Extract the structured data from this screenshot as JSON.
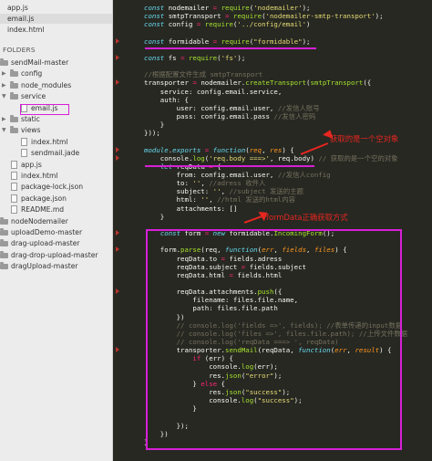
{
  "sidebar": {
    "open_files": [
      {
        "label": "app.js"
      },
      {
        "label": "email.js"
      },
      {
        "label": "index.html"
      }
    ],
    "folders_heading": "FOLDERS",
    "tree": [
      {
        "label": "sendMail-master",
        "kind": "folder",
        "depth": 0,
        "open": true
      },
      {
        "label": "config",
        "kind": "folder",
        "depth": 1,
        "open": false
      },
      {
        "label": "node_modules",
        "kind": "folder",
        "depth": 1,
        "open": false
      },
      {
        "label": "service",
        "kind": "folder",
        "depth": 1,
        "open": true
      },
      {
        "label": "email.js",
        "kind": "file",
        "depth": 2,
        "active": true
      },
      {
        "label": "static",
        "kind": "folder",
        "depth": 1,
        "open": false
      },
      {
        "label": "views",
        "kind": "folder",
        "depth": 1,
        "open": true
      },
      {
        "label": "index.html",
        "kind": "file",
        "depth": 2
      },
      {
        "label": "sendmail.jade",
        "kind": "file",
        "depth": 2
      },
      {
        "label": "app.js",
        "kind": "file",
        "depth": 1
      },
      {
        "label": "index.html",
        "kind": "file",
        "depth": 1
      },
      {
        "label": "package-lock.json",
        "kind": "file",
        "depth": 1
      },
      {
        "label": "package.json",
        "kind": "file",
        "depth": 1,
        "active": true
      },
      {
        "label": "README.md",
        "kind": "file",
        "depth": 1
      },
      {
        "label": "nodeNodemailer",
        "kind": "folder",
        "depth": 0
      },
      {
        "label": "uploadDemo-master",
        "kind": "folder",
        "depth": 0
      },
      {
        "label": "drag-upload-master",
        "kind": "folder",
        "depth": 0
      },
      {
        "label": "drag-drop-upload-master",
        "kind": "folder",
        "depth": 0
      },
      {
        "label": "dragUpload-master",
        "kind": "folder",
        "depth": 0
      }
    ]
  },
  "editor": {
    "lines": [
      [
        [
          "k",
          "const "
        ],
        [
          "w",
          "nodemailer "
        ],
        [
          "o",
          "= "
        ],
        [
          "f",
          "require"
        ],
        [
          "w",
          "("
        ],
        [
          "s",
          "'nodemailer'"
        ],
        [
          "w",
          ");"
        ]
      ],
      [
        [
          "k",
          "const "
        ],
        [
          "w",
          "smtpTransport "
        ],
        [
          "o",
          "= "
        ],
        [
          "f",
          "require"
        ],
        [
          "w",
          "("
        ],
        [
          "s",
          "'nodemailer-smtp-transport'"
        ],
        [
          "w",
          ");"
        ]
      ],
      [
        [
          "k",
          "const "
        ],
        [
          "w",
          "config "
        ],
        [
          "o",
          "= "
        ],
        [
          "f",
          "require"
        ],
        [
          "w",
          "("
        ],
        [
          "s",
          "'../config/email'"
        ],
        [
          "w",
          ")"
        ]
      ],
      [],
      [
        [
          "k",
          "const "
        ],
        [
          "w",
          "formidable "
        ],
        [
          "o",
          "= "
        ],
        [
          "f",
          "require"
        ],
        [
          "w",
          "("
        ],
        [
          "s",
          "\"formidable\""
        ],
        [
          "w",
          ");"
        ]
      ],
      [],
      [
        [
          "k",
          "const "
        ],
        [
          "w",
          "fs "
        ],
        [
          "o",
          "= "
        ],
        [
          "f",
          "require"
        ],
        [
          "w",
          "("
        ],
        [
          "s",
          "'fs'"
        ],
        [
          "w",
          ");"
        ]
      ],
      [],
      [
        [
          "c",
          "//根据配置文件生成 smtpTransport"
        ]
      ],
      [
        [
          "w",
          "transporter "
        ],
        [
          "o",
          "= "
        ],
        [
          "w",
          "nodemailer."
        ],
        [
          "f",
          "createTransport"
        ],
        [
          "w",
          "("
        ],
        [
          "f",
          "smtpTransport"
        ],
        [
          "w",
          "({"
        ]
      ],
      [
        [
          "w",
          "    service: config.email.service,"
        ]
      ],
      [
        [
          "w",
          "    auth: {"
        ]
      ],
      [
        [
          "w",
          "        user: config.email.user, "
        ],
        [
          "c",
          "//发信人账号"
        ]
      ],
      [
        [
          "w",
          "        pass: config.email.pass "
        ],
        [
          "c",
          "//发信人密码"
        ]
      ],
      [
        [
          "w",
          "    }"
        ]
      ],
      [
        [
          "w",
          "}));"
        ]
      ],
      [],
      [
        [
          "k",
          "module"
        ],
        [
          "w",
          "."
        ],
        [
          "k",
          "exports "
        ],
        [
          "o",
          "= "
        ],
        [
          "k",
          "function"
        ],
        [
          "w",
          "("
        ],
        [
          "p",
          "req"
        ],
        [
          "w",
          ", "
        ],
        [
          "p",
          "res"
        ],
        [
          "w",
          ") {"
        ]
      ],
      [
        [
          "w",
          "    console."
        ],
        [
          "f",
          "log"
        ],
        [
          "w",
          "("
        ],
        [
          "s",
          "'req.body ===>'"
        ],
        [
          "w",
          ", req.body) "
        ],
        [
          "c",
          "// 获取的是一个空的对象"
        ]
      ],
      [
        [
          "w",
          "    "
        ],
        [
          "k",
          "let "
        ],
        [
          "w",
          "reqData "
        ],
        [
          "o",
          "= "
        ],
        [
          "w",
          "{"
        ]
      ],
      [
        [
          "w",
          "        from: config.email.user, "
        ],
        [
          "c",
          "//发信人config"
        ]
      ],
      [
        [
          "w",
          "        to: "
        ],
        [
          "s",
          "''"
        ],
        [
          "w",
          ", "
        ],
        [
          "c",
          "//adress 收件人"
        ]
      ],
      [
        [
          "w",
          "        subject: "
        ],
        [
          "s",
          "''"
        ],
        [
          "w",
          ", "
        ],
        [
          "c",
          "//subject 发送的主题"
        ]
      ],
      [
        [
          "w",
          "        html: "
        ],
        [
          "s",
          "''"
        ],
        [
          "w",
          ", "
        ],
        [
          "c",
          "//html 发送的html内容"
        ]
      ],
      [
        [
          "w",
          "        attachments: []"
        ]
      ],
      [
        [
          "w",
          "    }"
        ]
      ],
      [],
      [
        [
          "w",
          "    "
        ],
        [
          "k",
          "const "
        ],
        [
          "w",
          "form "
        ],
        [
          "o",
          "= "
        ],
        [
          "k",
          "new "
        ],
        [
          "w",
          "formidable."
        ],
        [
          "f",
          "IncomingForm"
        ],
        [
          "w",
          "();"
        ]
      ],
      [],
      [
        [
          "w",
          "    form."
        ],
        [
          "f",
          "parse"
        ],
        [
          "w",
          "(req, "
        ],
        [
          "k",
          "function"
        ],
        [
          "w",
          "("
        ],
        [
          "p",
          "err"
        ],
        [
          "w",
          ", "
        ],
        [
          "p",
          "fields"
        ],
        [
          "w",
          ", "
        ],
        [
          "p",
          "files"
        ],
        [
          "w",
          ") {"
        ]
      ],
      [
        [
          "w",
          "        reqData.to "
        ],
        [
          "o",
          "= "
        ],
        [
          "w",
          "fields.adress"
        ]
      ],
      [
        [
          "w",
          "        reqData.subject "
        ],
        [
          "o",
          "= "
        ],
        [
          "w",
          "fields.subject"
        ]
      ],
      [
        [
          "w",
          "        reqData.html "
        ],
        [
          "o",
          "= "
        ],
        [
          "w",
          "fields.html"
        ]
      ],
      [],
      [
        [
          "w",
          "        reqData.attachments."
        ],
        [
          "f",
          "push"
        ],
        [
          "w",
          "({"
        ]
      ],
      [
        [
          "w",
          "            filename: files.file.name,"
        ]
      ],
      [
        [
          "w",
          "            path: files.file.path"
        ]
      ],
      [
        [
          "w",
          "        })"
        ]
      ],
      [
        [
          "c",
          "        // console.log('fields =>', fields); //表单传递的input数据"
        ]
      ],
      [
        [
          "c",
          "        // console.log('files =>', files.file.path); //上传文件数据"
        ]
      ],
      [
        [
          "c",
          "        // console.log('reqData ===> ', reqData)"
        ]
      ],
      [
        [
          "w",
          "        transporter."
        ],
        [
          "f",
          "sendMail"
        ],
        [
          "w",
          "(reqData, "
        ],
        [
          "k",
          "function"
        ],
        [
          "w",
          "("
        ],
        [
          "p",
          "err"
        ],
        [
          "w",
          ", "
        ],
        [
          "p",
          "result"
        ],
        [
          "w",
          ") {"
        ]
      ],
      [
        [
          "w",
          "            "
        ],
        [
          "o",
          "if "
        ],
        [
          "w",
          "(err) {"
        ]
      ],
      [
        [
          "w",
          "                console."
        ],
        [
          "f",
          "log"
        ],
        [
          "w",
          "(err);"
        ]
      ],
      [
        [
          "w",
          "                res."
        ],
        [
          "f",
          "json"
        ],
        [
          "w",
          "("
        ],
        [
          "s",
          "\"error\""
        ],
        [
          "w",
          ");"
        ]
      ],
      [
        [
          "w",
          "            } "
        ],
        [
          "o",
          "else "
        ],
        [
          "w",
          "{"
        ]
      ],
      [
        [
          "w",
          "                res."
        ],
        [
          "f",
          "json"
        ],
        [
          "w",
          "("
        ],
        [
          "s",
          "\"success\""
        ],
        [
          "w",
          ");"
        ]
      ],
      [
        [
          "w",
          "                console."
        ],
        [
          "f",
          "log"
        ],
        [
          "w",
          "("
        ],
        [
          "s",
          "\"success\""
        ],
        [
          "w",
          ");"
        ]
      ],
      [
        [
          "w",
          "            }"
        ]
      ],
      [],
      [
        [
          "w",
          "        });"
        ]
      ],
      [
        [
          "w",
          "    })"
        ]
      ],
      [
        [
          "w",
          "}"
        ]
      ]
    ]
  },
  "annotations": {
    "empty_object_note": "获取的是一个空对象",
    "formdata_note": "formData正确获取方式"
  },
  "colors": {
    "editor_bg": "#272822",
    "highlight_magenta": "#d61fd6",
    "annotation_red": "#e62620"
  }
}
